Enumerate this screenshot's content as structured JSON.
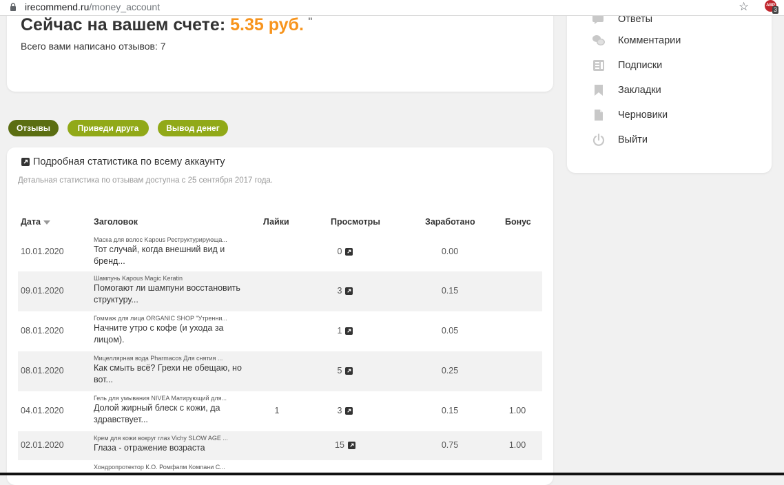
{
  "browser": {
    "url_host": "irecommend.ru",
    "url_path": "/money_account",
    "ext_badge_label": "ABP",
    "ext_badge_count": "3"
  },
  "balance": {
    "prefix": "Сейчас на вашем счете:",
    "amount": "5.35 руб.",
    "tick": "\"",
    "reviews_written": "Всего вами написано отзывов: 7"
  },
  "sidebar": {
    "items": [
      {
        "label": "Ответы"
      },
      {
        "label": "Комментарии"
      },
      {
        "label": "Подписки"
      },
      {
        "label": "Закладки"
      },
      {
        "label": "Черновики"
      },
      {
        "label": "Выйти"
      }
    ]
  },
  "tabs": [
    {
      "label": "Отзывы"
    },
    {
      "label": "Приведи друга"
    },
    {
      "label": "Вывод денег"
    }
  ],
  "stats": {
    "title": "Подробная статистика по всему аккаунту",
    "note": "Детальная статистика по отзывам доступна с 25 сентября 2017 года.",
    "columns": {
      "date": "Дата",
      "title": "Заголовок",
      "likes": "Лайки",
      "views": "Просмотры",
      "earned": "Заработано",
      "bonus": "Бонус"
    },
    "rows": [
      {
        "date": "10.01.2020",
        "product": "Маска для волос Kapous Реструктурирующа...",
        "head1": "Тот случай, когда внешний вид и",
        "head2": "бренд...",
        "likes": "",
        "views": "0",
        "earned": "0.00",
        "bonus": ""
      },
      {
        "date": "09.01.2020",
        "product": "Шампунь Kapous Magic Keratin",
        "head1": "Помогают ли шампуни восстановить",
        "head2": "структуру...",
        "likes": "",
        "views": "3",
        "earned": "0.15",
        "bonus": ""
      },
      {
        "date": "08.01.2020",
        "product": "Гоммаж для лица ORGANIC SHOP \"Утренни...",
        "head1": "Начните утро с кофе (и ухода за",
        "head2": "лицом).",
        "likes": "",
        "views": "1",
        "earned": "0.05",
        "bonus": ""
      },
      {
        "date": "08.01.2020",
        "product": "Мицеллярная вода Pharmacos Для снятия ...",
        "head1": "Как смыть всё? Грехи не обещаю, но",
        "head2": "вот...",
        "likes": "",
        "views": "5",
        "earned": "0.25",
        "bonus": ""
      },
      {
        "date": "04.01.2020",
        "product": "Гель для умывания NIVEA Матирующий для...",
        "head1": "Долой жирный блеск с кожи, да",
        "head2": "здравствует...",
        "likes": "1",
        "views": "3",
        "earned": "0.15",
        "bonus": "1.00"
      },
      {
        "date": "02.01.2020",
        "product": "Крем для кожи вокруг глаз Vichy SLOW AGE ...",
        "head1": "Глаза - отражение возраста",
        "head2": "",
        "likes": "",
        "views": "15",
        "earned": "0.75",
        "bonus": "1.00"
      },
      {
        "date": "",
        "product": "Хондропротектор К.О. Ромфапм Компани С...",
        "head1": "",
        "head2": "",
        "likes": "",
        "views": "",
        "earned": "",
        "bonus": ""
      }
    ]
  },
  "colors": {
    "accent_orange": "#f7941d",
    "tab_active": "#5b6e12",
    "tab_inactive": "#91a918"
  }
}
